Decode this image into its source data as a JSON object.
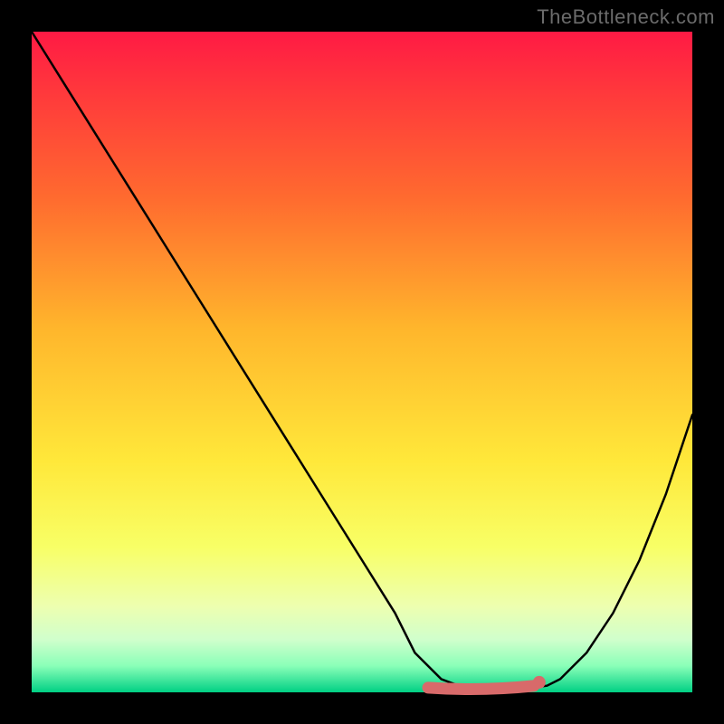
{
  "attribution": "TheBottleneck.com",
  "chart_data": {
    "type": "line",
    "title": "",
    "xlabel": "",
    "ylabel": "",
    "xlim": [
      0,
      100
    ],
    "ylim": [
      0,
      100
    ],
    "grid": false,
    "series": [
      {
        "name": "bottleneck-curve",
        "color": "#000000",
        "x": [
          0,
          5,
          10,
          15,
          20,
          25,
          30,
          35,
          40,
          45,
          50,
          55,
          58,
          62,
          66,
          70,
          74,
          78,
          80,
          84,
          88,
          92,
          96,
          100
        ],
        "y": [
          100,
          92,
          84,
          76,
          68,
          60,
          52,
          44,
          36,
          28,
          20,
          12,
          6,
          2,
          0.5,
          0.5,
          0.5,
          1,
          2,
          6,
          12,
          20,
          30,
          42
        ]
      },
      {
        "name": "sweet-spot-marker",
        "color": "#d86a6a",
        "type": "segment",
        "x": [
          60,
          76
        ],
        "y": [
          0.7,
          0.7
        ]
      }
    ]
  }
}
